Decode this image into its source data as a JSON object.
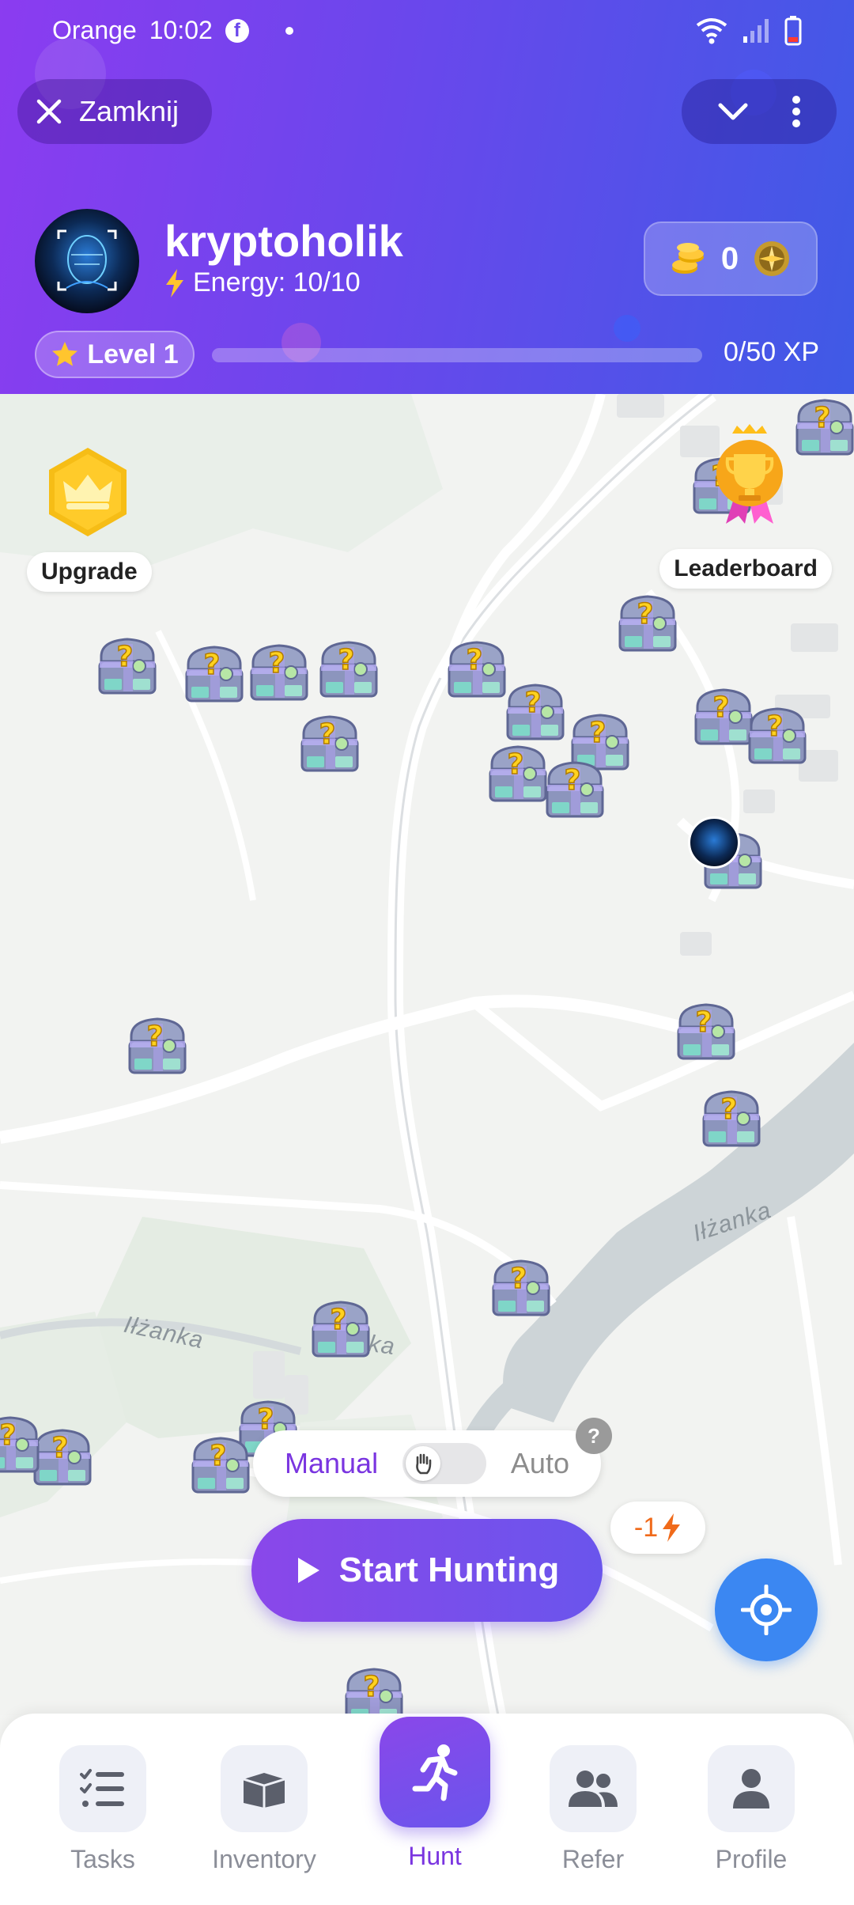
{
  "status_bar": {
    "carrier": "Orange",
    "time": "10:02",
    "fb_glyph": "f"
  },
  "header": {
    "close_label": "Zamknij",
    "username": "kryptoholik",
    "energy_label": "Energy: 10/10",
    "coins": "0",
    "level_label": "Level 1",
    "xp_progress": 0,
    "xp_text": "0/50 XP"
  },
  "map": {
    "upgrade_label": "Upgrade",
    "leaderboard_label": "Leaderboard",
    "river_label_1": "Iłżanka",
    "river_label_2": "Iłżanka",
    "river_label_3": "ka",
    "chest_glyph": "?",
    "chest_count": 26
  },
  "hunt": {
    "mode_manual": "Manual",
    "mode_auto": "Auto",
    "selected_mode": "Manual",
    "help_label": "?",
    "energy_cost": "-1",
    "start_label": "Start Hunting"
  },
  "nav": {
    "tasks": "Tasks",
    "inventory": "Inventory",
    "hunt": "Hunt",
    "refer": "Refer",
    "profile": "Profile"
  },
  "colors": {
    "accent": "#7a35e0",
    "header_start": "#8b3cf0",
    "header_end": "#3f5ae6",
    "locate": "#3b87f2",
    "energy": "#f06a1a",
    "gold": "#f5b400"
  }
}
